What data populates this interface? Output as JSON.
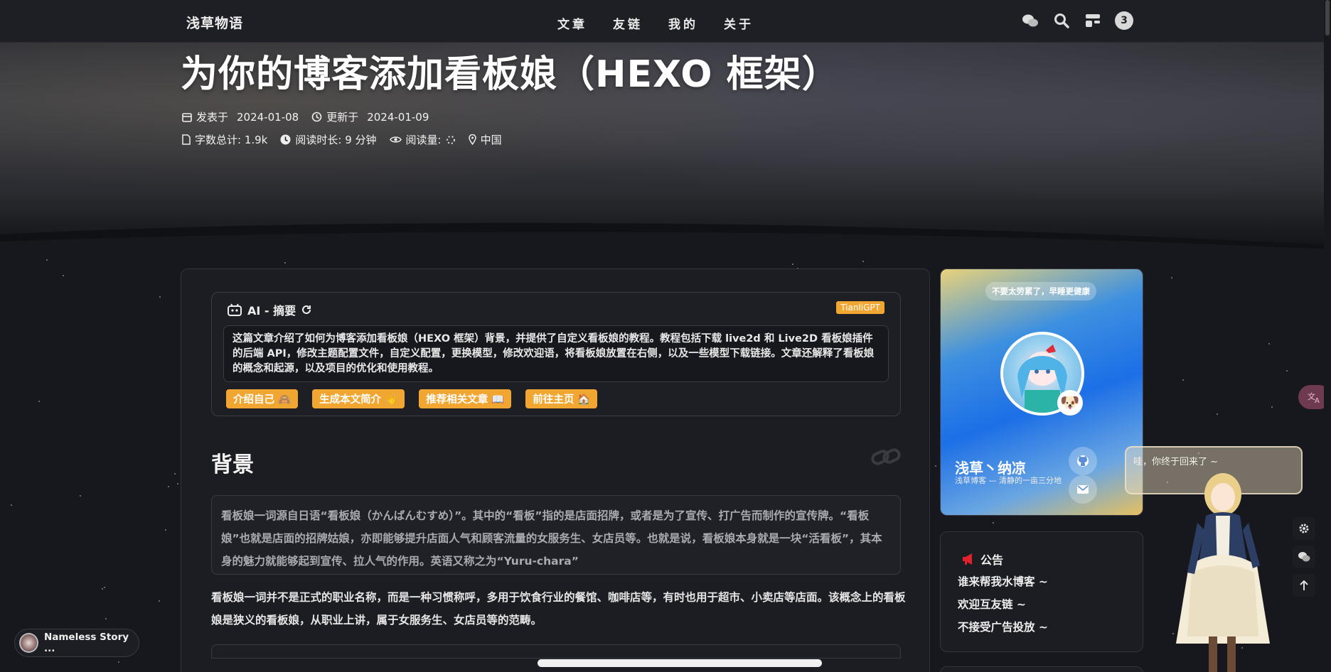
{
  "nav": {
    "brand": "浅草物语",
    "menu": [
      "文章",
      "友链",
      "我的",
      "关于"
    ],
    "notification_count": "3",
    "icons": [
      "wechat-icon",
      "search-icon",
      "layout-icon"
    ]
  },
  "post": {
    "title": "为你的博客添加看板娘（HEXO 框架）",
    "published_label": "发表于",
    "published_date": "2024-01-08",
    "updated_label": "更新于",
    "updated_date": "2024-01-09",
    "word_count": "字数总计: 1.9k",
    "read_time": "阅读时长: 9 分钟",
    "views_label": "阅读量:",
    "location": "中国"
  },
  "ai_summary": {
    "title": "AI - 摘要",
    "badge": "TianliGPT",
    "text": "这篇文章介绍了如何为博客添加看板娘（HEXO 框架）背景，并提供了自定义看板娘的教程。教程包括下载 live2d 和 Live2D 看板娘插件的后端 API，修改主题配置文件，自定义配置，更换模型，修改欢迎语，将看板娘放置在右侧，以及一些模型下载链接。文章还解释了看板娘的概念和起源，以及项目的优化和使用教程。",
    "buttons": [
      "介绍自己 🙈",
      "生成本文简介 👋",
      "推荐相关文章 📖",
      "前往主页 🏠"
    ]
  },
  "article": {
    "heading": "背景",
    "quote": "看板娘一词源自日语“看板娘（かんばんむすめ）”。其中的“看板”指的是店面招牌，或者是为了宣传、打广告而制作的宣传牌。“看板娘”也就是店面的招牌姑娘，亦即能够提升店面人气和顾客流量的女服务生、女店员等。也就是说，看板娘本身就是一块“活看板”，其本身的魅力就能够起到宣传、拉人气的作用。英语又称之为“Yuru-chara”",
    "paragraph": "看板娘一词并不是正式的职业名称，而是一种习惯称呼，多用于饮食行业的餐馆、咖啡店等，有时也用于超市、小卖店等店面。该概念上的看板娘是狭义的看板娘，从职业上讲，属于女服务生、女店员等的范畴。"
  },
  "profile": {
    "tip": "不要太劳累了，早睡更健康",
    "name": "浅草丶纳凉",
    "description": "浅草博客 — 清静的一亩三分地"
  },
  "notice": {
    "title": "公告",
    "items": [
      "谁来帮我水博客 ~",
      "欢迎互友链 ~",
      "不接受广告投放 ~"
    ]
  },
  "waifu": {
    "message": "哇，你终于回来了 ~"
  },
  "player": {
    "title": "Nameless Story ..."
  },
  "colors": {
    "accent": "#f0a630",
    "background": "#17181d",
    "card": "#1c1d22"
  }
}
